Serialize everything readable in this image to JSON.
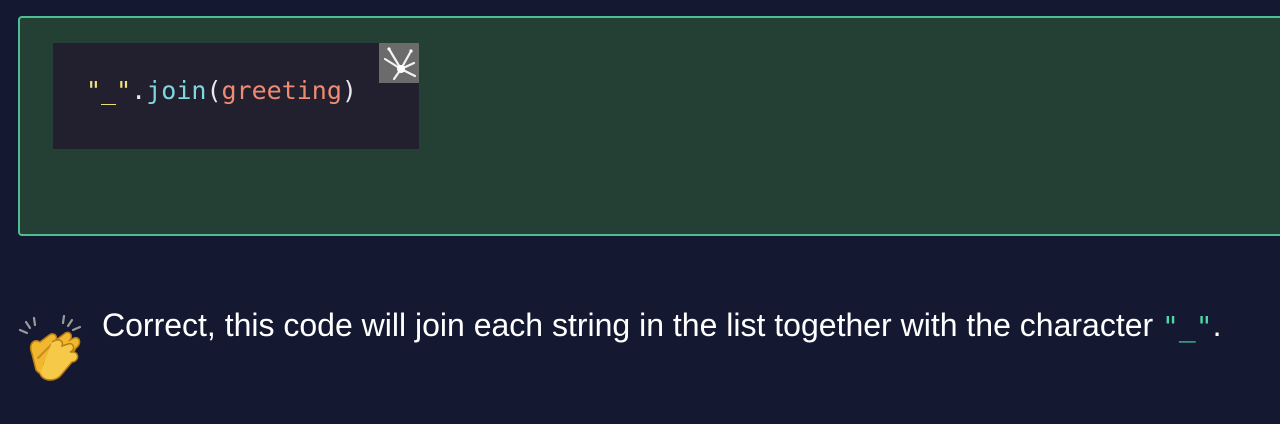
{
  "code_block": {
    "string_token": "\"_\"",
    "dot": ".",
    "method": "join",
    "open_paren": "(",
    "argument": "greeting",
    "close_paren": ")"
  },
  "icons": {
    "copy": "sparkle-copy-icon",
    "feedback": "clapping-hands-icon"
  },
  "feedback": {
    "text": "Correct, this code will join each string in the list together with the character ",
    "inline_code": "\"_\"",
    "trailing": "."
  },
  "colors": {
    "background": "#141830",
    "panel_background": "#243f34",
    "panel_border": "#4ebf92",
    "code_background": "#22202f",
    "string": "#f2e27a",
    "method": "#7ed7df",
    "argument": "#f08a70",
    "inline_code": "#4fd6a4"
  }
}
